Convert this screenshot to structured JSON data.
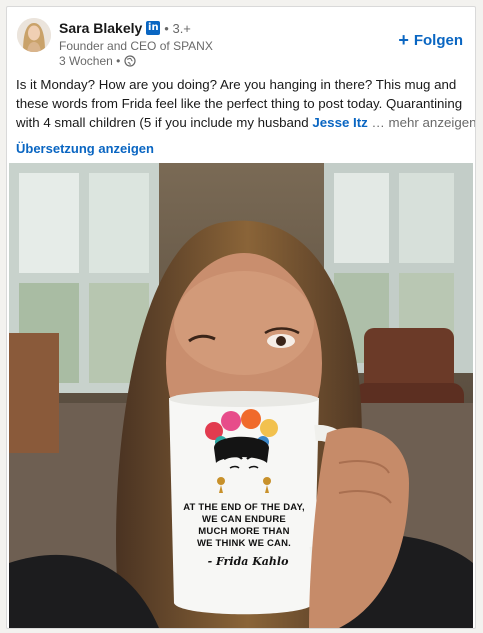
{
  "author": {
    "name": "Sara Blakely",
    "badge": "in",
    "degree": "• 3.+",
    "headline": "Founder and CEO of SPANX",
    "time": "3 Wochen •"
  },
  "actions": {
    "follow_label": "Folgen",
    "translate_label": "Übersetzung anzeigen"
  },
  "post": {
    "line1": "Is it Monday? How are you doing? Are you hanging in there? This mug and",
    "line2": "these words from Frida feel like the perfect thing to post today. Quarantining",
    "line3": "with 4 small children (5 if you include my husband",
    "mention": "Jesse Itz",
    "more": "… mehr anzeigen"
  },
  "mug": {
    "lines": [
      "AT THE END OF THE DAY,",
      "WE CAN ENDURE",
      "MUCH MORE THAN",
      "WE THINK WE CAN."
    ],
    "signature": "- Frida Kahlo"
  },
  "colors": {
    "link_blue": "#0a66c2",
    "linkedin_badge": "#0a66c2",
    "card_bg": "#ffffff",
    "page_bg": "#f3f2ef"
  },
  "icons": {
    "follow": "plus-icon",
    "visibility": "globe-icon",
    "network": "linkedin-badge-icon"
  }
}
